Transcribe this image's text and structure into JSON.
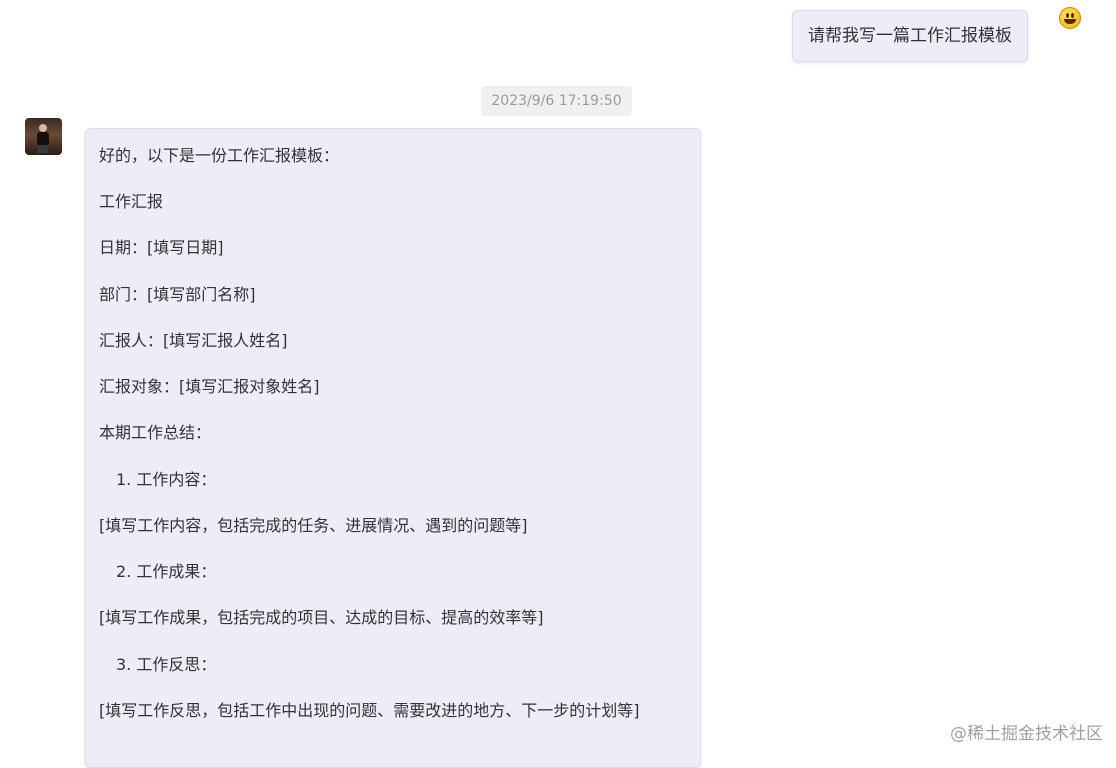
{
  "user_message": {
    "text": "请帮我写一篇工作汇报模板",
    "avatar_icon": "smiley-face-icon"
  },
  "timestamp": "2023/9/6 17:19:50",
  "bot_message": {
    "avatar_icon": "profile-photo",
    "lines": [
      "好的，以下是一份工作汇报模板：",
      "工作汇报",
      "日期：[填写日期]",
      "部门：[填写部门名称]",
      "汇报人：[填写汇报人姓名]",
      "汇报对象：[填写汇报对象姓名]",
      "本期工作总结：",
      "1. 工作内容：",
      "[填写工作内容，包括完成的任务、进展情况、遇到的问题等]",
      "2. 工作成果：",
      "[填写工作成果，包括完成的项目、达成的目标、提高的效率等]",
      "3. 工作反思：",
      "[填写工作反思，包括工作中出现的问题、需要改进的地方、下一步的计划等]"
    ]
  },
  "watermark": "@稀土掘金技术社区",
  "colors": {
    "bubble_bg": "#eeedf7",
    "bubble_border": "#dddbea",
    "timestamp_bg": "#f0f0f0",
    "timestamp_text": "#9b9b9b",
    "text": "#333333"
  }
}
